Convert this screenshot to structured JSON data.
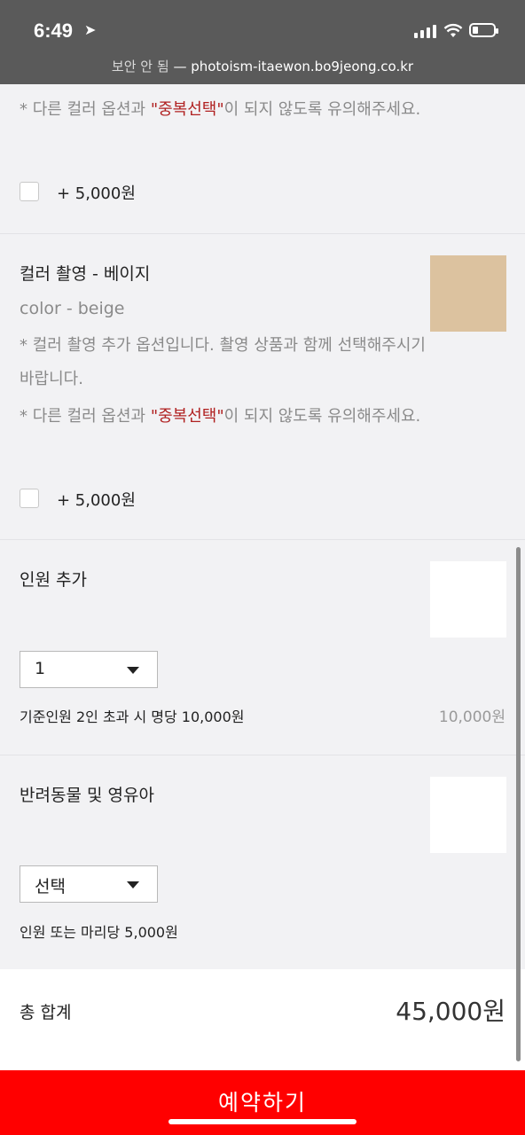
{
  "status_bar": {
    "time": "6:49",
    "location_icon": "location-arrow-icon",
    "icons": [
      "signal-icon",
      "wifi-icon",
      "battery-icon"
    ]
  },
  "url_bar": {
    "insecure_label": "보안 안 됨",
    "separator": " — ",
    "domain": "photoism-itaewon.bo9jeong.co.kr"
  },
  "section_top": {
    "note_prefix": "* 다른 컬러 옵션과 ",
    "note_emphasis": "\"중복선택\"",
    "note_suffix": "이 되지 않도록 유의해주세요.",
    "price": "+ 5,000원",
    "checked": false
  },
  "section_beige": {
    "title": "컬러 촬영 - 베이지",
    "subtitle": "color - beige",
    "note1": "* 컬러 촬영 추가 옵션입니다. 촬영 상품과 함께 선택해주시기 바랍니다.",
    "note2_prefix": "* 다른 컬러 옵션과 ",
    "note2_emphasis": "\"중복선택\"",
    "note2_suffix": "이 되지 않도록 유의해주세요.",
    "price": "+ 5,000원",
    "checked": false,
    "swatch_color": "#dcc29f"
  },
  "section_people": {
    "title": "인원 추가",
    "select_value": "1",
    "info": "기준인원 2인 초과 시 명당 10,000원",
    "amount": "10,000원"
  },
  "section_pets": {
    "title": "반려동물 및 영유아",
    "select_value": "선택",
    "info": "인원 또는 마리당 5,000원"
  },
  "total": {
    "label": "총 합계",
    "value": "45,000원"
  },
  "reserve_button": "예약하기",
  "colors": {
    "accent_red": "#ff0000",
    "emphasis_red": "#b02020",
    "beige": "#dcc29f"
  }
}
